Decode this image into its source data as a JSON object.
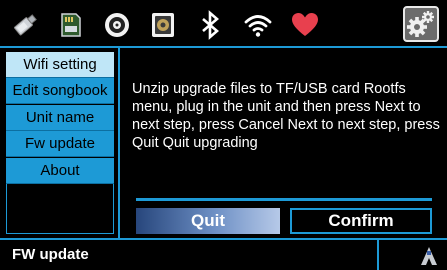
{
  "topbar": {
    "icons": [
      "usb-drive-icon",
      "sd-card-icon",
      "disc-icon",
      "speaker-icon",
      "bluetooth-icon",
      "wifi-icon",
      "heart-icon"
    ],
    "settings_icon": "gear-icon"
  },
  "menu": {
    "items": [
      {
        "label": "Wifi setting",
        "selected": true
      },
      {
        "label": "Edit songbook",
        "selected": false
      },
      {
        "label": "Unit name",
        "selected": false
      },
      {
        "label": "Fw update",
        "selected": false
      },
      {
        "label": "About",
        "selected": false
      }
    ]
  },
  "main": {
    "message": "Unzip upgrade files to TF/USB card  Rootfs menu, plug in the unit and then press Next to next step, press Cancel Next to next step, press Quit Quit upgrading",
    "quit_label": "Quit",
    "confirm_label": "Confirm"
  },
  "bottombar": {
    "title": "FW update",
    "icon": "person-icon"
  },
  "colors": {
    "accent": "#1d9ad6",
    "selected_item": "#bfe6f7",
    "heart": "#e8404e"
  }
}
